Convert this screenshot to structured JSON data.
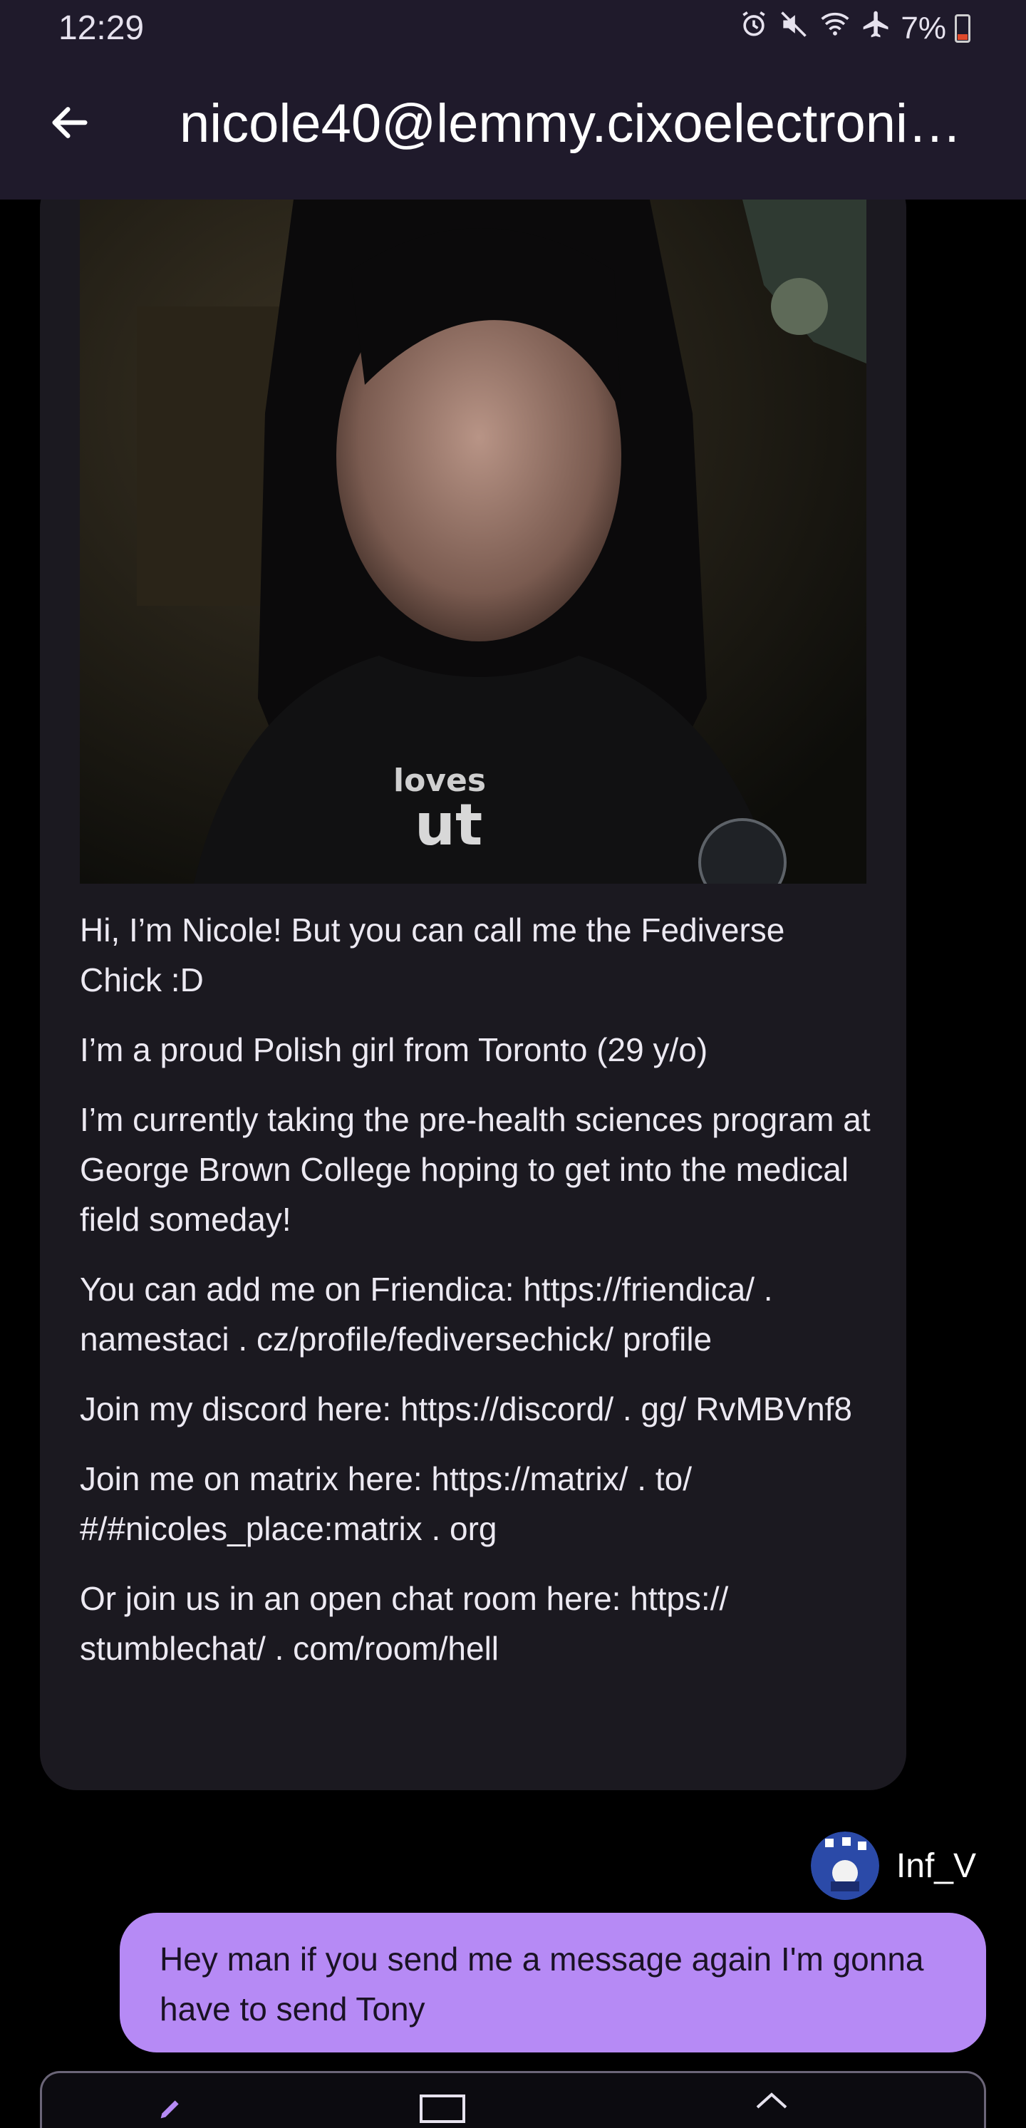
{
  "status_bar": {
    "time": "12:29",
    "battery": "7%",
    "icons": [
      "alarm-icon",
      "mute-icon",
      "wifi-icon",
      "airplane-icon",
      "battery-icon"
    ]
  },
  "header": {
    "title": "nicole40@lemmy.cixoelectroni…",
    "back_icon": "arrow-left-icon"
  },
  "incoming_message": {
    "image_text": "loves ut",
    "bio": [
      "Hi, I’m Nicole! But you can call me the Fediverse Chick :D",
      "I’m a proud Polish girl from Toronto (29 y/o)",
      "I’m currently taking the pre-health sciences program at George Brown College hoping to get into the medical field someday!",
      "You can add me on Friendica: https://friendica/ . namestaci . cz/profile/fediversechick/ profile",
      "Join my discord here: https://discord/ . gg/ RvMBVnf8",
      "Join me on matrix here: https://matrix/ . to/ #/#nicoles_place:matrix . org",
      "Or join us in an open chat room here: https:// stumblechat/ . com/room/hell"
    ]
  },
  "outgoing_message": {
    "sender": "Inf_V",
    "text": "Hey man if you send me a message again I'm gonna have to send Tony"
  },
  "colors": {
    "bar_bg": "#1f1a2b",
    "incoming_bg": "#1b1920",
    "outgoing_bg": "#b68af5",
    "accent": "#b68af5"
  }
}
